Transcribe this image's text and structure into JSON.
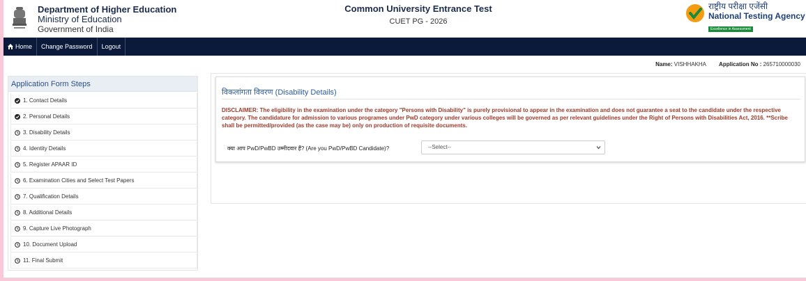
{
  "header": {
    "dept_line1": "Department of Higher Education",
    "dept_line2": "Ministry of Education",
    "dept_line3": "Government of India",
    "exam_title": "Common University Entrance Test",
    "exam_subtitle": "CUET PG - 2026",
    "nta_hindi": "राष्ट्रीय परीक्षा एजेंसी",
    "nta_english": "National Testing Agency",
    "nta_tagline": "Excellence in Assessment"
  },
  "nav": {
    "home": "Home",
    "change_password": "Change Password",
    "logout": "Logout"
  },
  "user": {
    "name_label": "Name:",
    "name_value": "VISHHAKHA",
    "app_label": "Application No :",
    "app_value": "265710000030"
  },
  "sidebar": {
    "title": "Application Form Steps",
    "items": [
      {
        "label": "1. Contact Details",
        "done": true
      },
      {
        "label": "2. Personal Details",
        "done": true
      },
      {
        "label": "3. Disability Details",
        "done": false
      },
      {
        "label": "4. Identity Details",
        "done": false
      },
      {
        "label": "5. Register APAAR ID",
        "done": false
      },
      {
        "label": "6. Examination Cities and Select Test Papers",
        "done": false
      },
      {
        "label": "7. Qualification Details",
        "done": false
      },
      {
        "label": "8. Additional Details",
        "done": false
      },
      {
        "label": "9. Capture Live Photograph",
        "done": false
      },
      {
        "label": "10. Document Upload",
        "done": false
      },
      {
        "label": "11. Final Submit",
        "done": false
      }
    ]
  },
  "main": {
    "section_title": "विकलांगता विवरण (Disability Details)",
    "disclaimer": "DISCLAIMER: The eligibility in the examination under the category \"Persons with Disability\" is purely provisional to appear in the examination and does not guarantee a seat to the candidate under the respective category. The candidature for admission to various programes under PwD category under various colleges will be governed as per relevant guidelines under the Right of Persons with Disabilities Act, 2016. **Scribe shall be permitted/provided (as the case may be) only on production of requisite documents.",
    "question": "क्या आप PwD/PwBD उम्मीदवार हैं? (Are you PwD/PwBD Candidate)?",
    "select_value": "--Select--"
  },
  "colors": {
    "navbar": "#0b1a3a",
    "disclaimer": "#a23b2c",
    "title_blue": "#2c5aa0",
    "border_pink": "#f9c9da"
  }
}
